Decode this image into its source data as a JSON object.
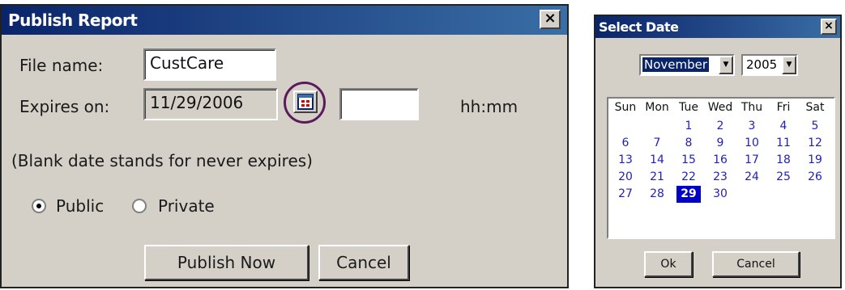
{
  "publish": {
    "title": "Publish Report",
    "close": "×",
    "file_label": "File name:",
    "file_value": "CustCare",
    "expires_label": "Expires on:",
    "expires_value": "11/29/2006",
    "time_value": "",
    "time_hint": "hh:mm",
    "note": "(Blank date stands for never expires)",
    "radio_public": "Public",
    "radio_private": "Private",
    "selected_visibility": "Public",
    "publish_btn": "Publish Now",
    "cancel_btn": "Cancel"
  },
  "select_date": {
    "title": "Select Date",
    "close": "×",
    "month": "November",
    "year": "2005",
    "weekdays": [
      "Sun",
      "Mon",
      "Tue",
      "Wed",
      "Thu",
      "Fri",
      "Sat"
    ],
    "days": [
      "1",
      "2",
      "3",
      "4",
      "5",
      "6",
      "7",
      "8",
      "9",
      "10",
      "11",
      "12",
      "13",
      "14",
      "15",
      "16",
      "17",
      "18",
      "19",
      "20",
      "21",
      "22",
      "23",
      "24",
      "25",
      "26",
      "27",
      "28",
      "29",
      "30"
    ],
    "first_weekday_index": 2,
    "selected_day": "29",
    "ok_btn": "Ok",
    "cancel_btn": "Cancel"
  },
  "colors": {
    "titlebar": "#0a246a",
    "dialog_bg": "#d4d0c8",
    "day_text": "#1f1fb8",
    "highlight_ring": "#5b1a5b"
  }
}
